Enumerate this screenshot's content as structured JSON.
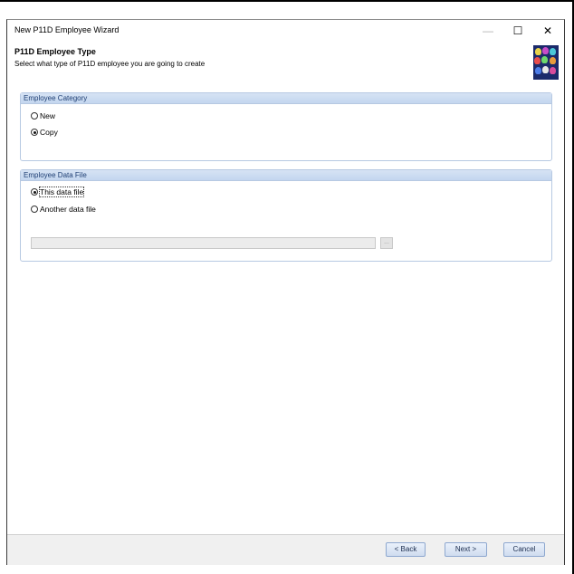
{
  "window": {
    "title": "New P11D Employee Wizard",
    "minimize_glyph": "—",
    "maximize_glyph": "☐",
    "close_glyph": "✕"
  },
  "header": {
    "title": "P11D Employee Type",
    "subtitle": "Select what type of P11D employee you are going to create",
    "icon": "people-group-icon"
  },
  "employee_category": {
    "label": "Employee Category",
    "options": [
      {
        "label": "New",
        "checked": false
      },
      {
        "label": "Copy",
        "checked": true
      }
    ]
  },
  "employee_data_file": {
    "label": "Employee Data File",
    "options": [
      {
        "label": "This data file",
        "checked": true
      },
      {
        "label": "Another data file",
        "checked": false
      }
    ],
    "path_value": "",
    "browse_label": "..."
  },
  "footer": {
    "back_label": "< Back",
    "next_label": "Next >",
    "cancel_label": "Cancel"
  },
  "colors": {
    "group_header_text": "#1f3f74",
    "group_border": "#b7c9e2",
    "button_border": "#8ea8cf",
    "icon_background": "#1b2a6b"
  }
}
